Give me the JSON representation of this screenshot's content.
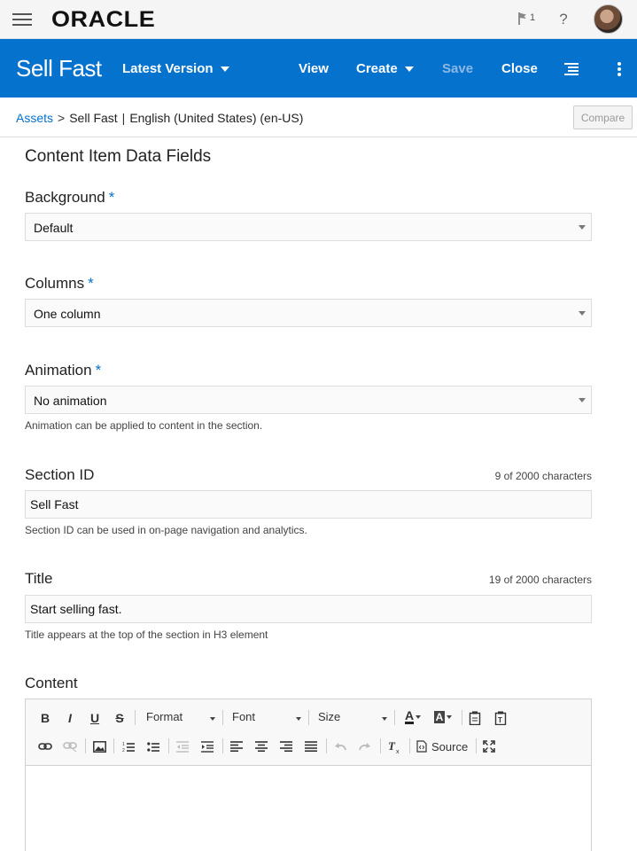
{
  "topbar": {
    "logo": "ORACLE",
    "notification_count": "1",
    "help_label": "?"
  },
  "header": {
    "title": "Sell Fast",
    "version_label": "Latest Version",
    "view_label": "View",
    "create_label": "Create",
    "save_label": "Save",
    "close_label": "Close",
    "accent_color": "#0572ce"
  },
  "breadcrumb": {
    "root": "Assets",
    "separator": ">",
    "item": "Sell Fast",
    "divider": "|",
    "language": "English (United States) (en-US)"
  },
  "compare_label": "Compare",
  "form": {
    "heading": "Content Item Data Fields",
    "required_mark": "*",
    "background": {
      "label": "Background",
      "value": "Default"
    },
    "columns": {
      "label": "Columns",
      "value": "One column"
    },
    "animation": {
      "label": "Animation",
      "value": "No animation",
      "help": "Animation can be applied to content in the section."
    },
    "section_id": {
      "label": "Section ID",
      "count": "9 of 2000 characters",
      "value": "Sell Fast",
      "help": "Section ID can be used in on-page navigation and analytics."
    },
    "title": {
      "label": "Title",
      "count": "19 of 2000 characters",
      "value": "Start selling fast.",
      "help": "Title appears at the top of the section in H3 element"
    },
    "content": {
      "label": "Content"
    }
  },
  "editor": {
    "bold": "B",
    "italic": "I",
    "underline": "U",
    "strike": "S",
    "format_label": "Format",
    "font_label": "Font",
    "size_label": "Size",
    "text_color": "A",
    "bg_color": "A",
    "source_label": "Source"
  }
}
